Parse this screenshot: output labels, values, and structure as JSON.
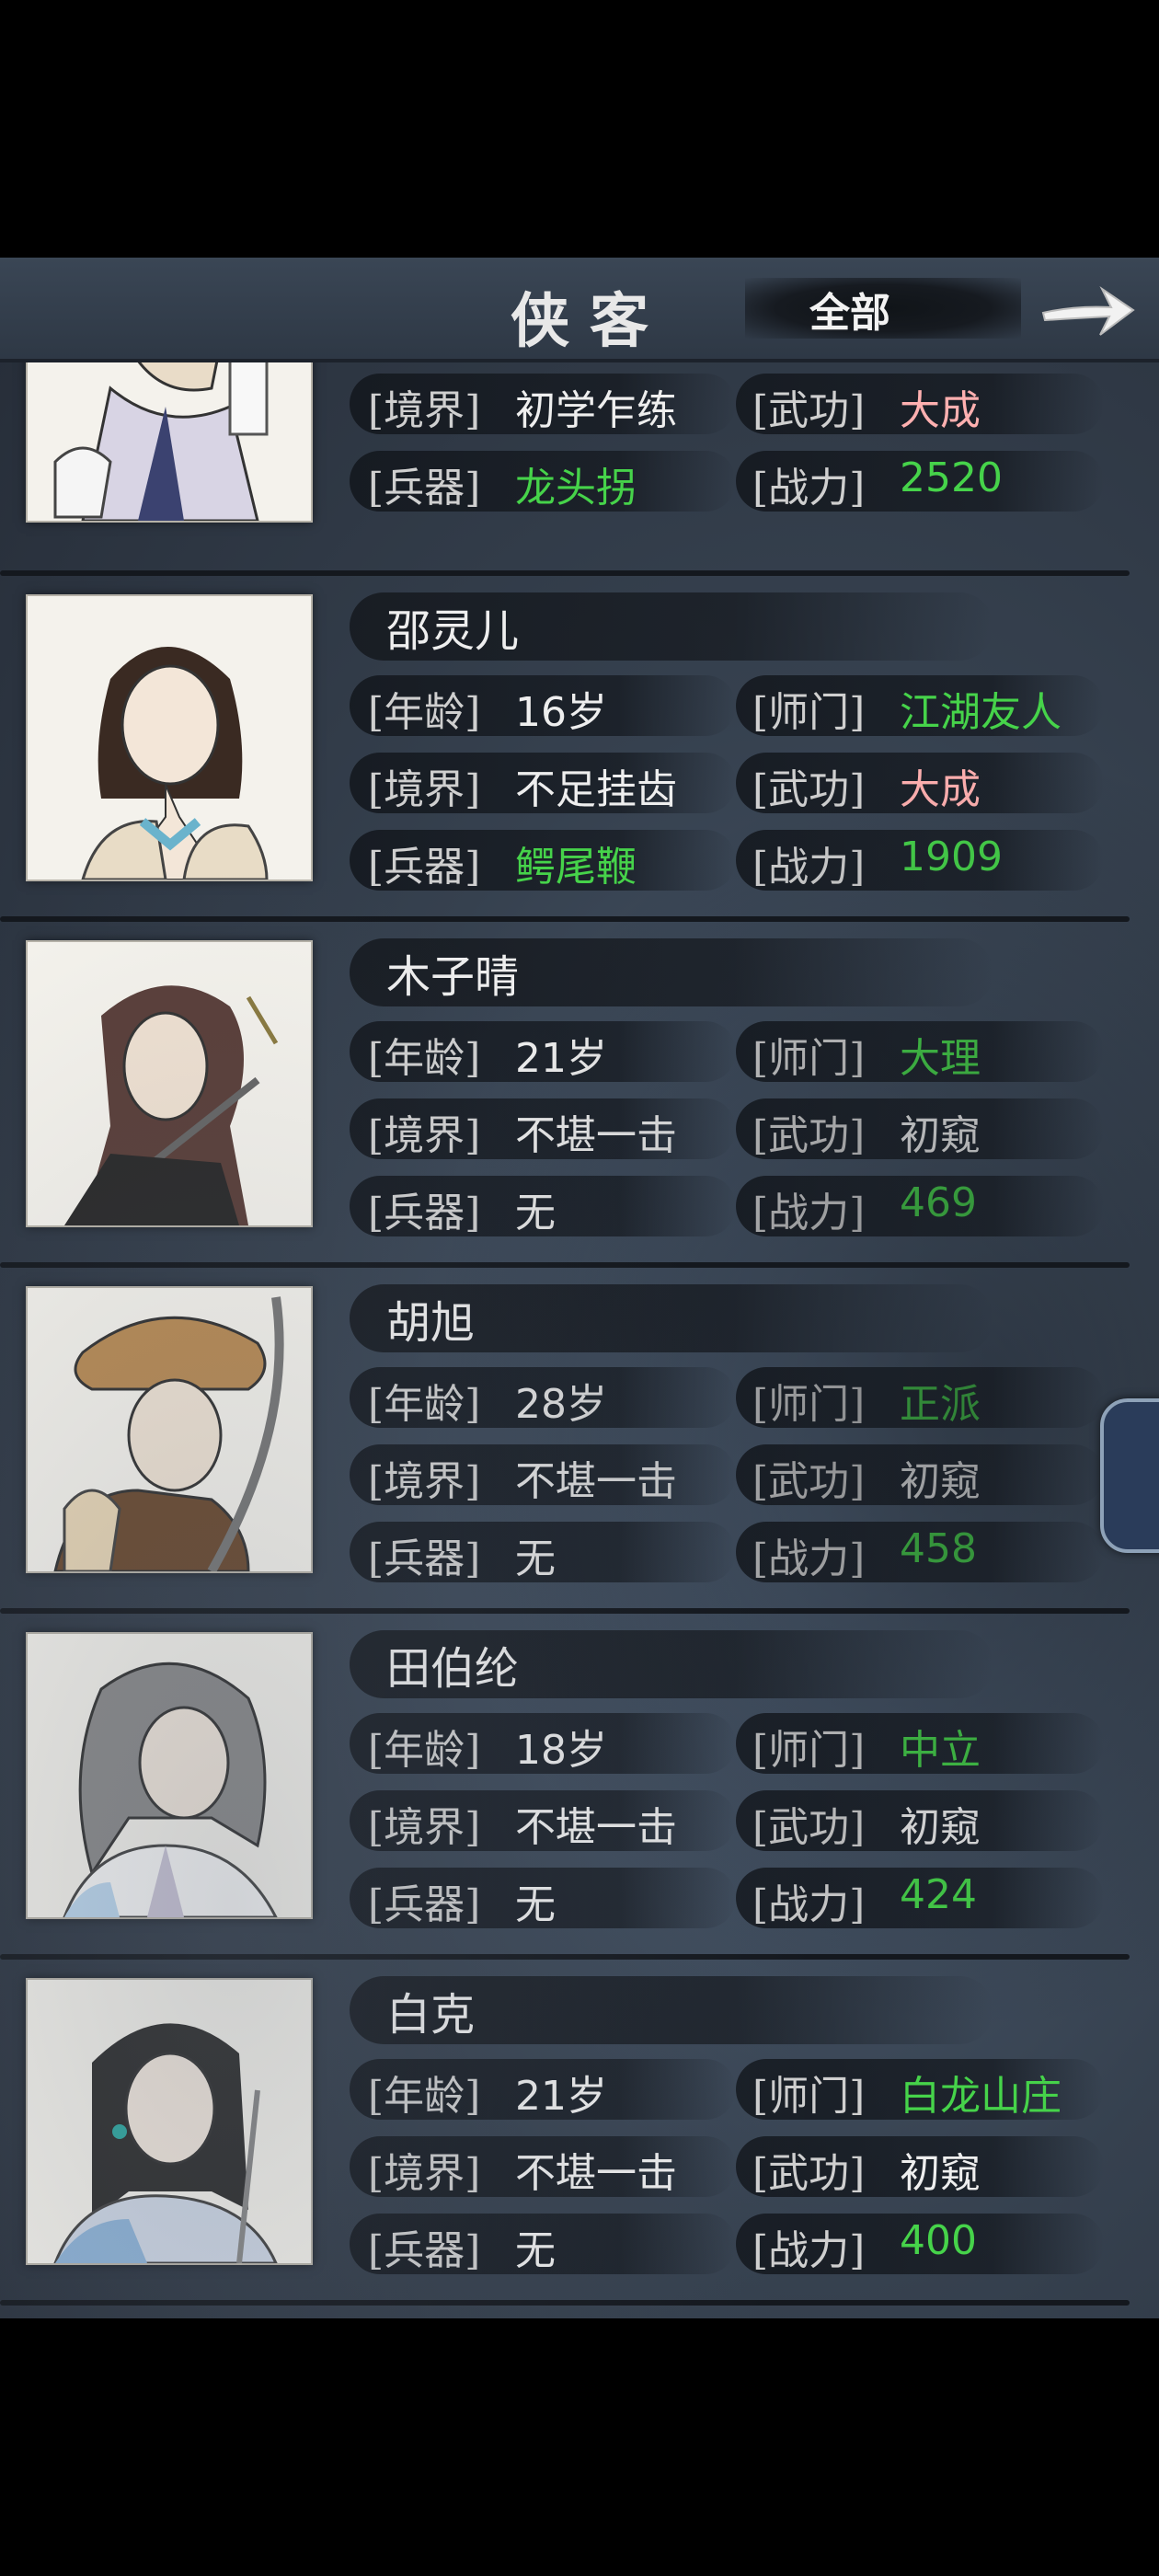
{
  "header": {
    "title": "侠客",
    "filter": "全部"
  },
  "labels": {
    "age": "[年龄]",
    "sect": "[师门]",
    "realm": "[境界]",
    "skill": "[武功]",
    "weapon": "[兵器]",
    "power": "[战力]"
  },
  "first_partial": {
    "realm": "初学乍练",
    "skill": "大成",
    "weapon": "龙头拐",
    "power": "2520"
  },
  "heroes": [
    {
      "name": "邵灵儿",
      "age": "16岁",
      "sect": "江湖友人",
      "realm": "不足挂齿",
      "skill": "大成",
      "weapon": "鳄尾鞭",
      "power": "1909"
    },
    {
      "name": "木子晴",
      "age": "21岁",
      "sect": "大理",
      "realm": "不堪一击",
      "skill": "初窥",
      "weapon": "无",
      "power": "469"
    },
    {
      "name": "胡旭",
      "age": "28岁",
      "sect": "正派",
      "realm": "不堪一击",
      "skill": "初窥",
      "weapon": "无",
      "power": "458"
    },
    {
      "name": "田伯纶",
      "age": "18岁",
      "sect": "中立",
      "realm": "不堪一击",
      "skill": "初窥",
      "weapon": "无",
      "power": "424"
    },
    {
      "name": "白克",
      "age": "21岁",
      "sect": "白龙山庄",
      "realm": "不堪一击",
      "skill": "初窥",
      "weapon": "无",
      "power": "400"
    }
  ],
  "colors": {
    "green": "#46d34a",
    "pink": "#ffb0b0",
    "text": "#eeeeee"
  }
}
